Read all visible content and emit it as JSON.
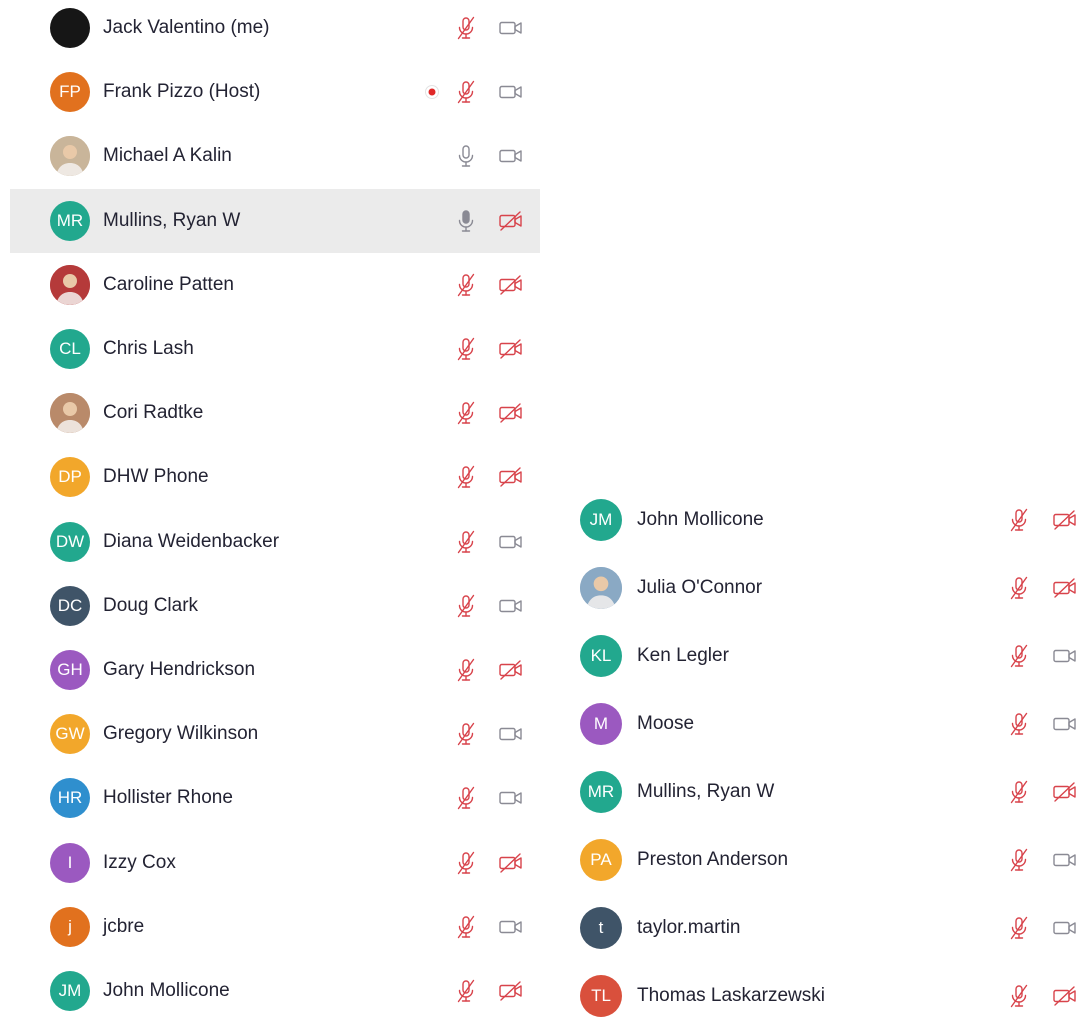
{
  "colors": {
    "muted": "#d8434b",
    "icon": "#8a8a94",
    "recording": "#e02828",
    "highlight": "#ebebeb",
    "text": "#232333"
  },
  "left_list": [
    {
      "name": "Jack Valentino (me)",
      "initials": "",
      "avatar": "solid",
      "color": "#161616",
      "mic": "muted",
      "video": "on"
    },
    {
      "name": "Frank Pizzo (Host)",
      "initials": "FP",
      "avatar": "initials",
      "color": "#e1711e",
      "mic": "muted",
      "video": "on",
      "recording": true
    },
    {
      "name": "Michael A Kalin",
      "initials": "",
      "avatar": "photo",
      "color": "#c9b59a",
      "mic": "on",
      "video": "on"
    },
    {
      "name": "Mullins, Ryan W",
      "initials": "MR",
      "avatar": "initials",
      "color": "#22a88e",
      "mic": "active",
      "video": "off",
      "highlighted": true
    },
    {
      "name": "Caroline Patten",
      "initials": "",
      "avatar": "photo",
      "color": "#b53a3a",
      "mic": "muted",
      "video": "off"
    },
    {
      "name": "Chris Lash",
      "initials": "CL",
      "avatar": "initials",
      "color": "#22a88e",
      "mic": "muted",
      "video": "off"
    },
    {
      "name": "Cori Radtke",
      "initials": "",
      "avatar": "photo",
      "color": "#b98a6a",
      "mic": "muted",
      "video": "off"
    },
    {
      "name": "DHW Phone",
      "initials": "DP",
      "avatar": "initials",
      "color": "#f2a72b",
      "mic": "muted",
      "video": "off"
    },
    {
      "name": "Diana Weidenbacker",
      "initials": "DW",
      "avatar": "initials",
      "color": "#22a88e",
      "mic": "muted",
      "video": "on"
    },
    {
      "name": "Doug Clark",
      "initials": "DC",
      "avatar": "initials",
      "color": "#3f5468",
      "mic": "muted",
      "video": "on"
    },
    {
      "name": "Gary Hendrickson",
      "initials": "GH",
      "avatar": "initials",
      "color": "#9b59c0",
      "mic": "muted",
      "video": "off"
    },
    {
      "name": "Gregory Wilkinson",
      "initials": "GW",
      "avatar": "initials",
      "color": "#f2a72b",
      "mic": "muted",
      "video": "on"
    },
    {
      "name": "Hollister Rhone",
      "initials": "HR",
      "avatar": "initials",
      "color": "#2f8fce",
      "mic": "muted",
      "video": "on"
    },
    {
      "name": "Izzy Cox",
      "initials": "I",
      "avatar": "initials",
      "color": "#9b59c0",
      "mic": "muted",
      "video": "off"
    },
    {
      "name": "jcbre",
      "initials": "j",
      "avatar": "initials",
      "color": "#e1711e",
      "mic": "muted",
      "video": "on"
    },
    {
      "name": "John Mollicone",
      "initials": "JM",
      "avatar": "initials",
      "color": "#22a88e",
      "mic": "muted",
      "video": "off"
    }
  ],
  "right_list": [
    {
      "name": "John Mollicone",
      "initials": "JM",
      "avatar": "initials",
      "color": "#22a88e",
      "mic": "muted",
      "video": "off"
    },
    {
      "name": "Julia O'Connor",
      "initials": "",
      "avatar": "photo",
      "color": "#8aa9c4",
      "mic": "muted",
      "video": "off"
    },
    {
      "name": "Ken Legler",
      "initials": "KL",
      "avatar": "initials",
      "color": "#22a88e",
      "mic": "muted",
      "video": "on"
    },
    {
      "name": "Moose",
      "initials": "M",
      "avatar": "initials",
      "color": "#9b59c0",
      "mic": "muted",
      "video": "on"
    },
    {
      "name": "Mullins, Ryan W",
      "initials": "MR",
      "avatar": "initials",
      "color": "#22a88e",
      "mic": "muted",
      "video": "off"
    },
    {
      "name": "Preston Anderson",
      "initials": "PA",
      "avatar": "initials",
      "color": "#f2a72b",
      "mic": "muted",
      "video": "on"
    },
    {
      "name": "taylor.martin",
      "initials": "t",
      "avatar": "initials",
      "color": "#3f5468",
      "mic": "muted",
      "video": "on"
    },
    {
      "name": "Thomas Laskarzewski",
      "initials": "TL",
      "avatar": "initials",
      "color": "#d9503c",
      "mic": "muted",
      "video": "off"
    }
  ]
}
